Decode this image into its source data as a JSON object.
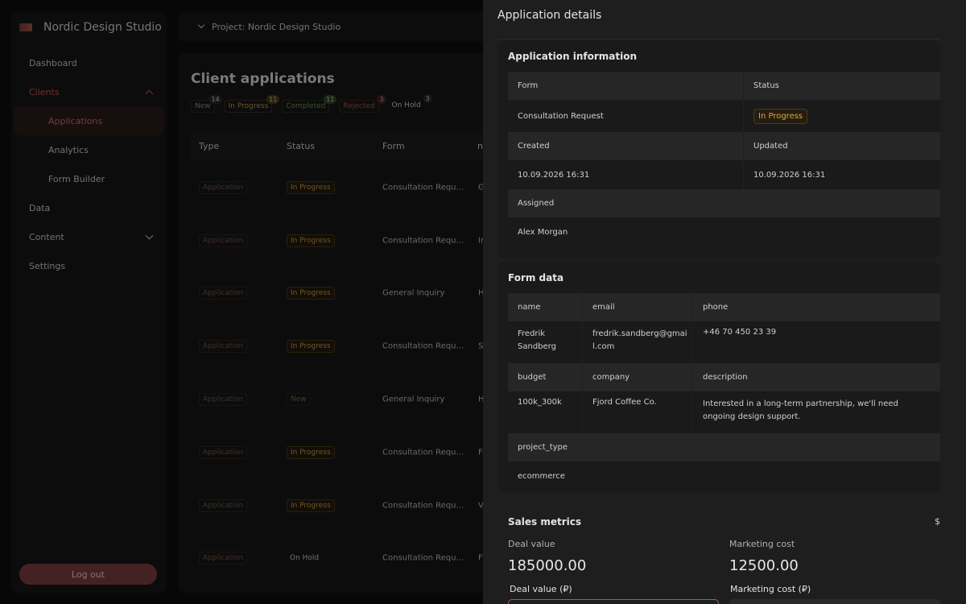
{
  "app": {
    "name": "Nordic Design Studio"
  },
  "sidebar": {
    "items": [
      {
        "label": "Dashboard"
      },
      {
        "label": "Clients"
      },
      {
        "label": "Applications"
      },
      {
        "label": "Analytics"
      },
      {
        "label": "Form Builder"
      },
      {
        "label": "Data"
      },
      {
        "label": "Content"
      },
      {
        "label": "Settings"
      }
    ],
    "logout_label": "Log out"
  },
  "topbar": {
    "project_label": "Project: Nordic Design Studio"
  },
  "main": {
    "title": "Client applications",
    "filters": [
      {
        "label": "New",
        "count": "14"
      },
      {
        "label": "In Progress",
        "count": "11"
      },
      {
        "label": "Completed",
        "count": "11"
      },
      {
        "label": "Rejected",
        "count": "3"
      },
      {
        "label": "On Hold",
        "count": "3"
      }
    ],
    "columns": [
      "Type",
      "Status",
      "Form",
      "n"
    ],
    "rows": [
      {
        "type": "Application",
        "status": "In Progress",
        "form": "Consultation Requ...",
        "n": "G"
      },
      {
        "type": "Application",
        "status": "In Progress",
        "form": "Consultation Requ...",
        "n": "Ir"
      },
      {
        "type": "Application",
        "status": "In Progress",
        "form": "General Inquiry",
        "n": "H"
      },
      {
        "type": "Application",
        "status": "In Progress",
        "form": "Consultation Requ...",
        "n": "S"
      },
      {
        "type": "Application",
        "status": "New",
        "form": "General Inquiry",
        "n": "H"
      },
      {
        "type": "Application",
        "status": "In Progress",
        "form": "Consultation Requ...",
        "n": "F"
      },
      {
        "type": "Application",
        "status": "In Progress",
        "form": "Consultation Requ...",
        "n": "V"
      },
      {
        "type": "Application",
        "status": "On Hold",
        "form": "Consultation Requ...",
        "n": "F"
      }
    ]
  },
  "panel": {
    "title": "Application details",
    "info": {
      "title": "Application information",
      "form_label": "Form",
      "status_label": "Status",
      "form_value": "Consultation Request",
      "status_value": "In Progress",
      "created_label": "Created",
      "updated_label": "Updated",
      "created_value": "10.09.2026 16:31",
      "updated_value": "10.09.2026 16:31",
      "assigned_label": "Assigned",
      "assigned_value": "Alex Morgan"
    },
    "form_data": {
      "title": "Form data",
      "name_label": "name",
      "email_label": "email",
      "phone_label": "phone",
      "name_value": "Fredrik Sandberg",
      "email_value": "fredrik.sandberg@gmail.com",
      "phone_value": "+46 70 450 23 39",
      "budget_label": "budget",
      "company_label": "company",
      "description_label": "description",
      "budget_value": "100k_300k",
      "company_value": "Fjord Coffee Co.",
      "description_value": "Interested in a long-term partnership, we'll need ongoing design support.",
      "project_type_label": "project_type",
      "project_type_value": "ecommerce"
    },
    "metrics": {
      "title": "Sales metrics",
      "currency_symbol": "$",
      "deal_label": "Deal value",
      "deal_value": "185000.00",
      "marketing_label": "Marketing cost",
      "marketing_value": "12500.00",
      "deal_input_label": "Deal value (₽)",
      "marketing_input_label": "Marketing cost (₽)"
    }
  },
  "colors": {
    "accent": "#d56a5c",
    "in_progress": "#d39a3e",
    "completed": "#6f8f54",
    "rejected": "#b2524a",
    "logout": "#7d3e40"
  }
}
